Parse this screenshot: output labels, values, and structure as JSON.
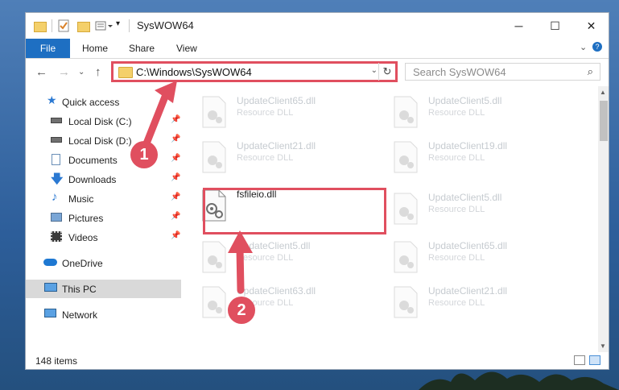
{
  "window": {
    "title": "SysWOW64",
    "controls": {
      "minimize": "─",
      "maximize": "☐",
      "close": "✕"
    }
  },
  "ribbon": {
    "tabs": [
      "File",
      "Home",
      "Share",
      "View"
    ],
    "expand_icon": "chevron-down-icon",
    "help_icon": "help-icon"
  },
  "address_bar": {
    "path": "C:\\Windows\\SysWOW64",
    "dropdown_icon": "chevron-down-icon",
    "refresh_icon": "refresh-icon"
  },
  "search": {
    "placeholder": "Search SysWOW64"
  },
  "sidebar": {
    "items": [
      {
        "label": "Quick access",
        "icon": "star-icon"
      },
      {
        "label": "Local Disk (C:)",
        "icon": "drive-icon",
        "pinned": true
      },
      {
        "label": "Local Disk (D:)",
        "icon": "drive-icon",
        "pinned": true
      },
      {
        "label": "Documents",
        "icon": "documents-icon",
        "pinned": true
      },
      {
        "label": "Downloads",
        "icon": "download-icon",
        "pinned": true
      },
      {
        "label": "Music",
        "icon": "music-icon",
        "pinned": true
      },
      {
        "label": "Pictures",
        "icon": "pictures-icon",
        "pinned": true
      },
      {
        "label": "Videos",
        "icon": "videos-icon",
        "pinned": true
      },
      {
        "label": "OneDrive",
        "icon": "cloud-icon"
      },
      {
        "label": "This PC",
        "icon": "computer-icon",
        "selected": true
      },
      {
        "label": "Network",
        "icon": "network-icon"
      }
    ]
  },
  "files": {
    "left": [
      {
        "name": "UpdateClient65.dll",
        "type": "Resource DLL"
      },
      {
        "name": "UpdateClient21.dll",
        "type": "Resource DLL"
      },
      {
        "name": "fsfileio.dll",
        "type": "",
        "selected": true
      },
      {
        "name": "UpdateClient5.dll",
        "type": "Resource DLL"
      },
      {
        "name": "UpdateClient63.dll",
        "type": "Resource DLL"
      }
    ],
    "right": [
      {
        "name": "UpdateClient5.dll",
        "type": "Resource DLL"
      },
      {
        "name": "UpdateClient19.dll",
        "type": "Resource DLL"
      },
      {
        "name": "UpdateClient5.dll",
        "type": "Resource DLL"
      },
      {
        "name": "UpdateClient65.dll",
        "type": "Resource DLL"
      },
      {
        "name": "UpdateClient21.dll",
        "type": "Resource DLL"
      }
    ]
  },
  "status": {
    "item_count": "148 items"
  },
  "annotations": {
    "marker1": "1",
    "marker2": "2",
    "color": "#e04f5f"
  }
}
